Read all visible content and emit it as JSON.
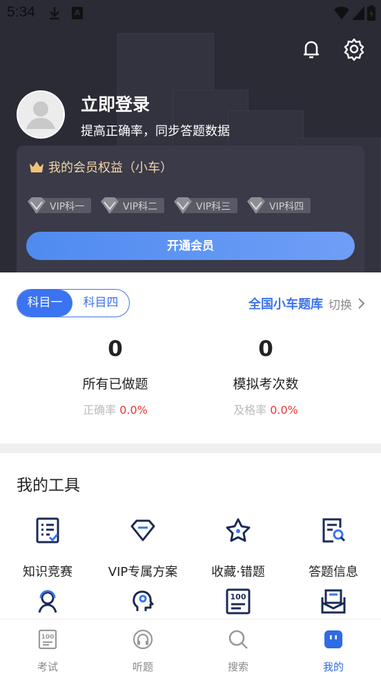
{
  "status_bar": {
    "time": "5:34"
  },
  "profile": {
    "title": "立即登录",
    "subtitle": "提高正确率，同步答题数据"
  },
  "vip": {
    "title": "我的会员权益（小车）",
    "tags": [
      "VIP科一",
      "VIP科二",
      "VIP科三",
      "VIP科四"
    ],
    "button": "开通会员"
  },
  "subjects": {
    "active": "科目一",
    "inactive": "科目四"
  },
  "bank": {
    "name": "全国小车题库",
    "switch": "切换"
  },
  "stats": [
    {
      "value": "0",
      "label": "所有已做题",
      "rate_label": "正确率",
      "rate_value": "0.0%"
    },
    {
      "value": "0",
      "label": "模拟考次数",
      "rate_label": "及格率",
      "rate_value": "0.0%"
    }
  ],
  "tools": {
    "title": "我的工具",
    "items": [
      {
        "label": "知识竞赛",
        "icon": "quiz-list-icon"
      },
      {
        "label": "VIP专属方案",
        "icon": "diamond-icon"
      },
      {
        "label": "收藏·错题",
        "icon": "star-icon"
      },
      {
        "label": "答题信息",
        "icon": "document-search-icon"
      },
      {
        "label": "",
        "icon": "person-support-icon"
      },
      {
        "label": "",
        "icon": "head-brain-icon"
      },
      {
        "label": "",
        "icon": "score-100-icon"
      },
      {
        "label": "",
        "icon": "mail-tray-icon"
      }
    ]
  },
  "tabbar": [
    {
      "label": "考试",
      "icon": "exam-icon"
    },
    {
      "label": "听题",
      "icon": "headphone-icon"
    },
    {
      "label": "搜索",
      "icon": "search-icon"
    },
    {
      "label": "我的",
      "icon": "mine-icon",
      "active": true
    }
  ],
  "colors": {
    "accent": "#3b73f0",
    "header_bg": "#2b2b36",
    "vip_gold": "#f3d5a6",
    "rate_red": "#e53935"
  }
}
